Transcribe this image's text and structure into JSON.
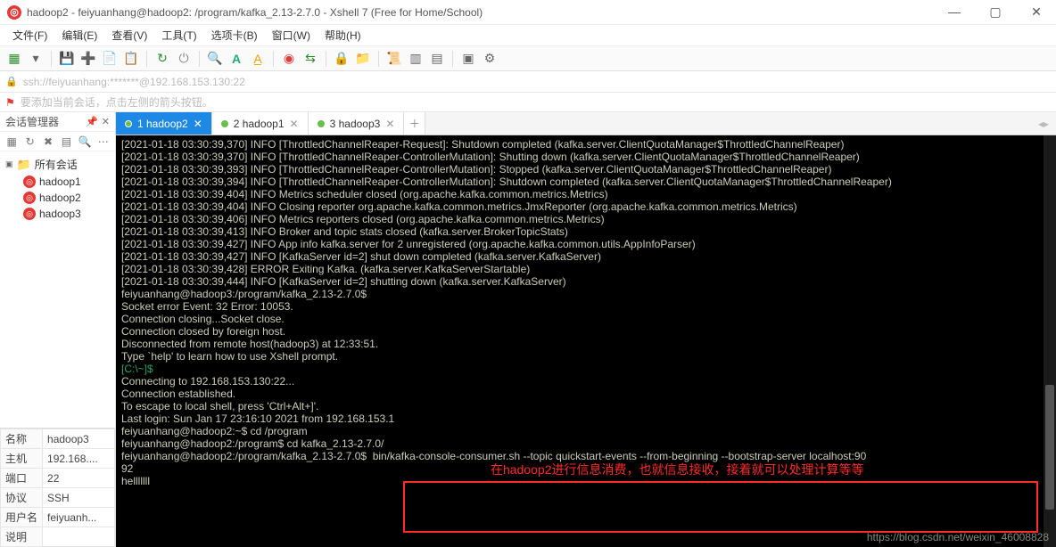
{
  "window": {
    "title": "hadoop2 - feiyuanhang@hadoop2: /program/kafka_2.13-2.7.0 - Xshell 7 (Free for Home/School)",
    "min": "—",
    "max": "▢",
    "close": "✕"
  },
  "menu": [
    "文件(F)",
    "编辑(E)",
    "查看(V)",
    "工具(T)",
    "选项卡(B)",
    "窗口(W)",
    "帮助(H)"
  ],
  "address": "ssh://feiyuanhang:*******@192.168.153.130:22",
  "hint": "要添加当前会话，点击左侧的箭头按钮。",
  "session_panel": {
    "title": "会话管理器",
    "root": "所有会话",
    "items": [
      "hadoop1",
      "hadoop2",
      "hadoop3"
    ]
  },
  "props": {
    "rows": [
      {
        "k": "名称",
        "v": "hadoop3"
      },
      {
        "k": "主机",
        "v": "192.168...."
      },
      {
        "k": "端口",
        "v": "22"
      },
      {
        "k": "协议",
        "v": "SSH"
      },
      {
        "k": "用户名",
        "v": "feiyuanh..."
      },
      {
        "k": "说明",
        "v": ""
      }
    ]
  },
  "tabs": [
    {
      "label": "1 hadoop2",
      "active": true
    },
    {
      "label": "2 hadoop1",
      "active": false
    },
    {
      "label": "3 hadoop3",
      "active": false
    }
  ],
  "terminal": {
    "lines": [
      "[2021-01-18 03:30:39,370] INFO [ThrottledChannelReaper-Request]: Shutdown completed (kafka.server.ClientQuotaManager$ThrottledChannelReaper)",
      "[2021-01-18 03:30:39,370] INFO [ThrottledChannelReaper-ControllerMutation]: Shutting down (kafka.server.ClientQuotaManager$ThrottledChannelReaper)",
      "[2021-01-18 03:30:39,393] INFO [ThrottledChannelReaper-ControllerMutation]: Stopped (kafka.server.ClientQuotaManager$ThrottledChannelReaper)",
      "[2021-01-18 03:30:39,394] INFO [ThrottledChannelReaper-ControllerMutation]: Shutdown completed (kafka.server.ClientQuotaManager$ThrottledChannelReaper)",
      "[2021-01-18 03:30:39,404] INFO Metrics scheduler closed (org.apache.kafka.common.metrics.Metrics)",
      "[2021-01-18 03:30:39,404] INFO Closing reporter org.apache.kafka.common.metrics.JmxReporter (org.apache.kafka.common.metrics.Metrics)",
      "[2021-01-18 03:30:39,406] INFO Metrics reporters closed (org.apache.kafka.common.metrics.Metrics)",
      "[2021-01-18 03:30:39,413] INFO Broker and topic stats closed (kafka.server.BrokerTopicStats)",
      "[2021-01-18 03:30:39,427] INFO App info kafka.server for 2 unregistered (org.apache.kafka.common.utils.AppInfoParser)",
      "[2021-01-18 03:30:39,427] INFO [KafkaServer id=2] shut down completed (kafka.server.KafkaServer)",
      "[2021-01-18 03:30:39,428] ERROR Exiting Kafka. (kafka.server.KafkaServerStartable)",
      "[2021-01-18 03:30:39,444] INFO [KafkaServer id=2] shutting down (kafka.server.KafkaServer)",
      "feiyuanhang@hadoop3:/program/kafka_2.13-2.7.0$",
      "Socket error Event: 32 Error: 10053.",
      "Connection closing...Socket close.",
      "",
      "Connection closed by foreign host.",
      "",
      "Disconnected from remote host(hadoop3) at 12:33:51.",
      "",
      "Type `help' to learn how to use Xshell prompt.",
      "",
      "",
      "Connecting to 192.168.153.130:22...",
      "Connection established.",
      "To escape to local shell, press 'Ctrl+Alt+]'.",
      "",
      "Last login: Sun Jan 17 23:16:10 2021 from 192.168.153.1",
      "feiyuanhang@hadoop2:~$ cd /program",
      "feiyuanhang@hadoop2:/program$ cd kafka_2.13-2.7.0/",
      "feiyuanhang@hadoop2:/program/kafka_2.13-2.7.0$  bin/kafka-console-consumer.sh --topic quickstart-events --from-beginning --bootstrap-server localhost:90",
      "92",
      "helllllll"
    ],
    "local_prompt": "[C:\\~]$",
    "annotation": "在hadoop2进行信息消费，也就信息接收，接着就可以处理计算等等",
    "watermark": "https://blog.csdn.net/weixin_46008828"
  }
}
